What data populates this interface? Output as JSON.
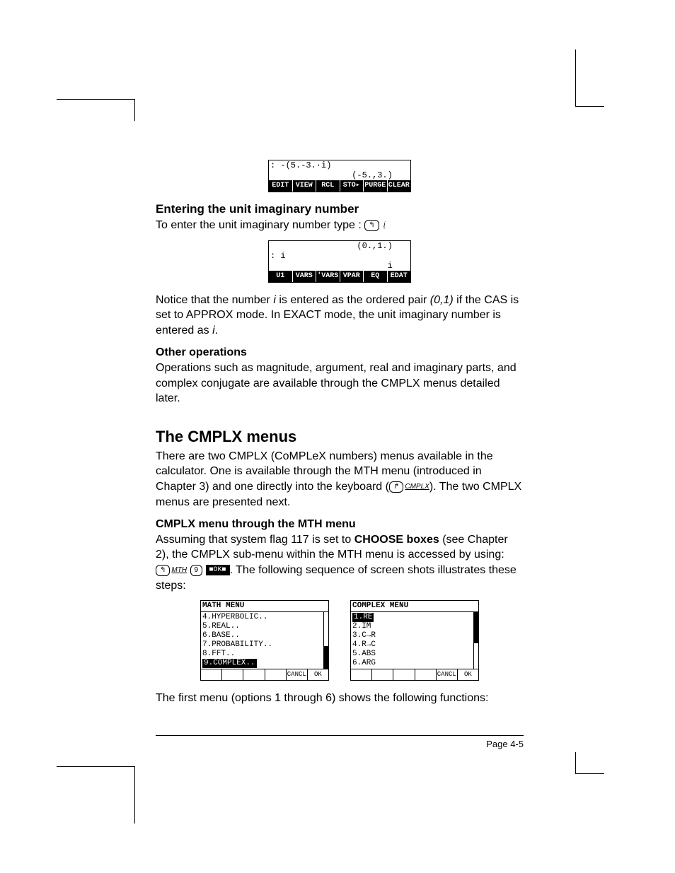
{
  "screen1": {
    "line1": ": -(5.-3.·i)",
    "line2": "                (-5.,3.)",
    "keys": [
      "EDIT",
      "VIEW",
      "RCL",
      "STO▸",
      "PURGE",
      "CLEAR"
    ]
  },
  "sec1": {
    "title": "Entering the unit imaginary number",
    "intro": "To enter the unit imaginary number type : ",
    "key1": "↰",
    "keylabel1": "i"
  },
  "screen2": {
    "line1": "                 (0.,1.)",
    "line2": ": i",
    "line3": "                       i",
    "keys": [
      "U1",
      "VARS",
      "'VARS",
      "VPAR",
      "EQ",
      "EDAT"
    ]
  },
  "para1a": "Notice that the number ",
  "para1b": " is entered as the ordered pair ",
  "para1c": " if the CAS is set to APPROX mode.  In EXACT mode, the unit imaginary number is entered as ",
  "i": "i",
  "pair": "(0,1)",
  "sec2": {
    "title": "Other operations",
    "body": "Operations such as magnitude, argument, real and imaginary parts, and complex conjugate are available through the CMPLX menus detailed later."
  },
  "h2": "The CMPLX menus",
  "para2a": "There are two CMPLX (CoMPLeX numbers) menus available in the calculator. One is available through the MTH menu (introduced in Chapter 3) and one directly into the keyboard (",
  "para2b": ").  The two CMPLX menus are presented next.",
  "key_rshift": "↱",
  "key_cmplx": "CMPLX",
  "sec3": {
    "title": "CMPLX menu through the MTH menu",
    "a": "Assuming that system flag 117 is set to ",
    "choose": "CHOOSE boxes",
    "b": " (see Chapter 2), the CMPLX sub-menu within the MTH menu is accessed by using: ",
    "key1": "↰",
    "klab1": "MTH",
    "key2": "9",
    "klab2": "",
    "okbtn": "■OK■",
    "c": ".  The following sequence of screen shots illustrates these steps:"
  },
  "menuL": {
    "title": "MATH MENU",
    "items": [
      "4.HYPERBOLIC..",
      "5.REAL..",
      "6.BASE..",
      "7.PROBABILITY..",
      "8.FFT.."
    ],
    "hl": "9.COMPLEX..",
    "soft": [
      "",
      "",
      "",
      "",
      "CANCL",
      "OK"
    ]
  },
  "menuR": {
    "title": "COMPLEX MENU",
    "hl": "1.RE",
    "items": [
      "2.IM",
      "3.C→R",
      "4.R→C",
      "5.ABS",
      "6.ARG"
    ],
    "soft": [
      "",
      "",
      "",
      "",
      "CANCL",
      "OK"
    ]
  },
  "para3": "The first menu (options 1 through 6) shows the following functions:",
  "footer": "Page 4-5"
}
